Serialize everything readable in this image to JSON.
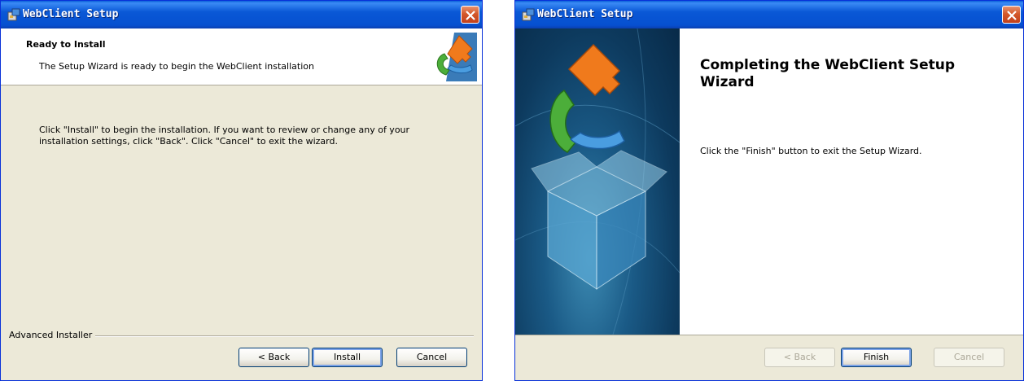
{
  "left_window": {
    "title": "WebClient Setup",
    "header_title": "Ready to Install",
    "header_subtitle": "The Setup Wizard is ready to begin the WebClient installation",
    "body_line1": "Click \"Install\" to begin the installation.  If you want to review or change any of your",
    "body_line2": "installation settings, click \"Back\".  Click \"Cancel\" to exit the wizard.",
    "brand": "Advanced Installer",
    "back_label": "< Back",
    "install_label": "Install",
    "cancel_label": "Cancel"
  },
  "right_window": {
    "title": "WebClient Setup",
    "heading": "Completing the WebClient Setup Wizard",
    "body": "Click the \"Finish\" button to exit the Setup Wizard.",
    "back_label": "< Back",
    "finish_label": "Finish",
    "cancel_label": "Cancel"
  },
  "colors": {
    "titlebar": "#0a58d6",
    "dialog_bg": "#ece9d8",
    "close": "#d4582a"
  },
  "icons": [
    "setup-app-icon",
    "close-icon",
    "puzzle-logo-icon",
    "box-puzzle-illustration"
  ]
}
